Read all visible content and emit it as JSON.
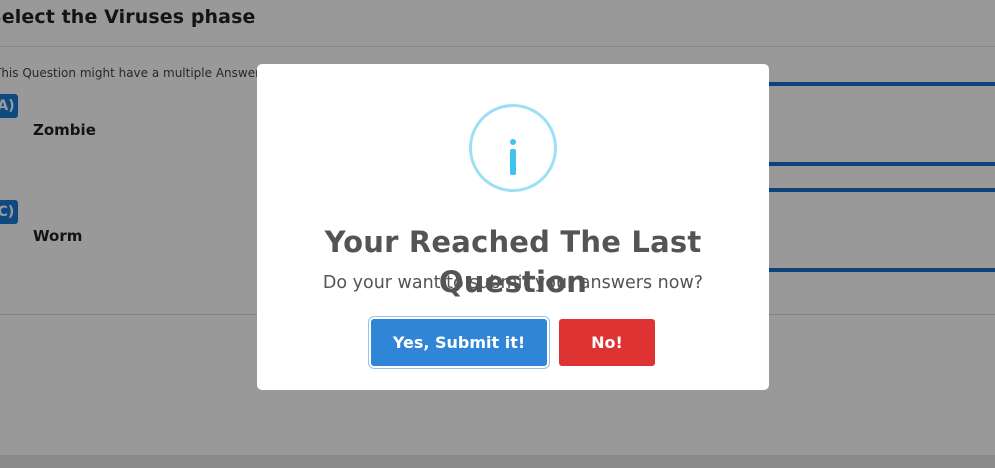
{
  "question": {
    "title": "Select the Viruses phase",
    "hint": "This Question might have a multiple Answers",
    "options": [
      {
        "badge": "A)",
        "text": "Zombie"
      },
      {
        "badge": "C)",
        "text": "Worm"
      }
    ]
  },
  "dialog": {
    "icon": "info-icon",
    "title": "Your Reached The Last Question",
    "text": "Do your want to submit your answers now?",
    "confirm_label": "Yes, Submit it!",
    "cancel_label": "No!",
    "colors": {
      "confirm": "#3085d6",
      "cancel": "#dd3333",
      "icon": "#3fc3ee"
    }
  }
}
